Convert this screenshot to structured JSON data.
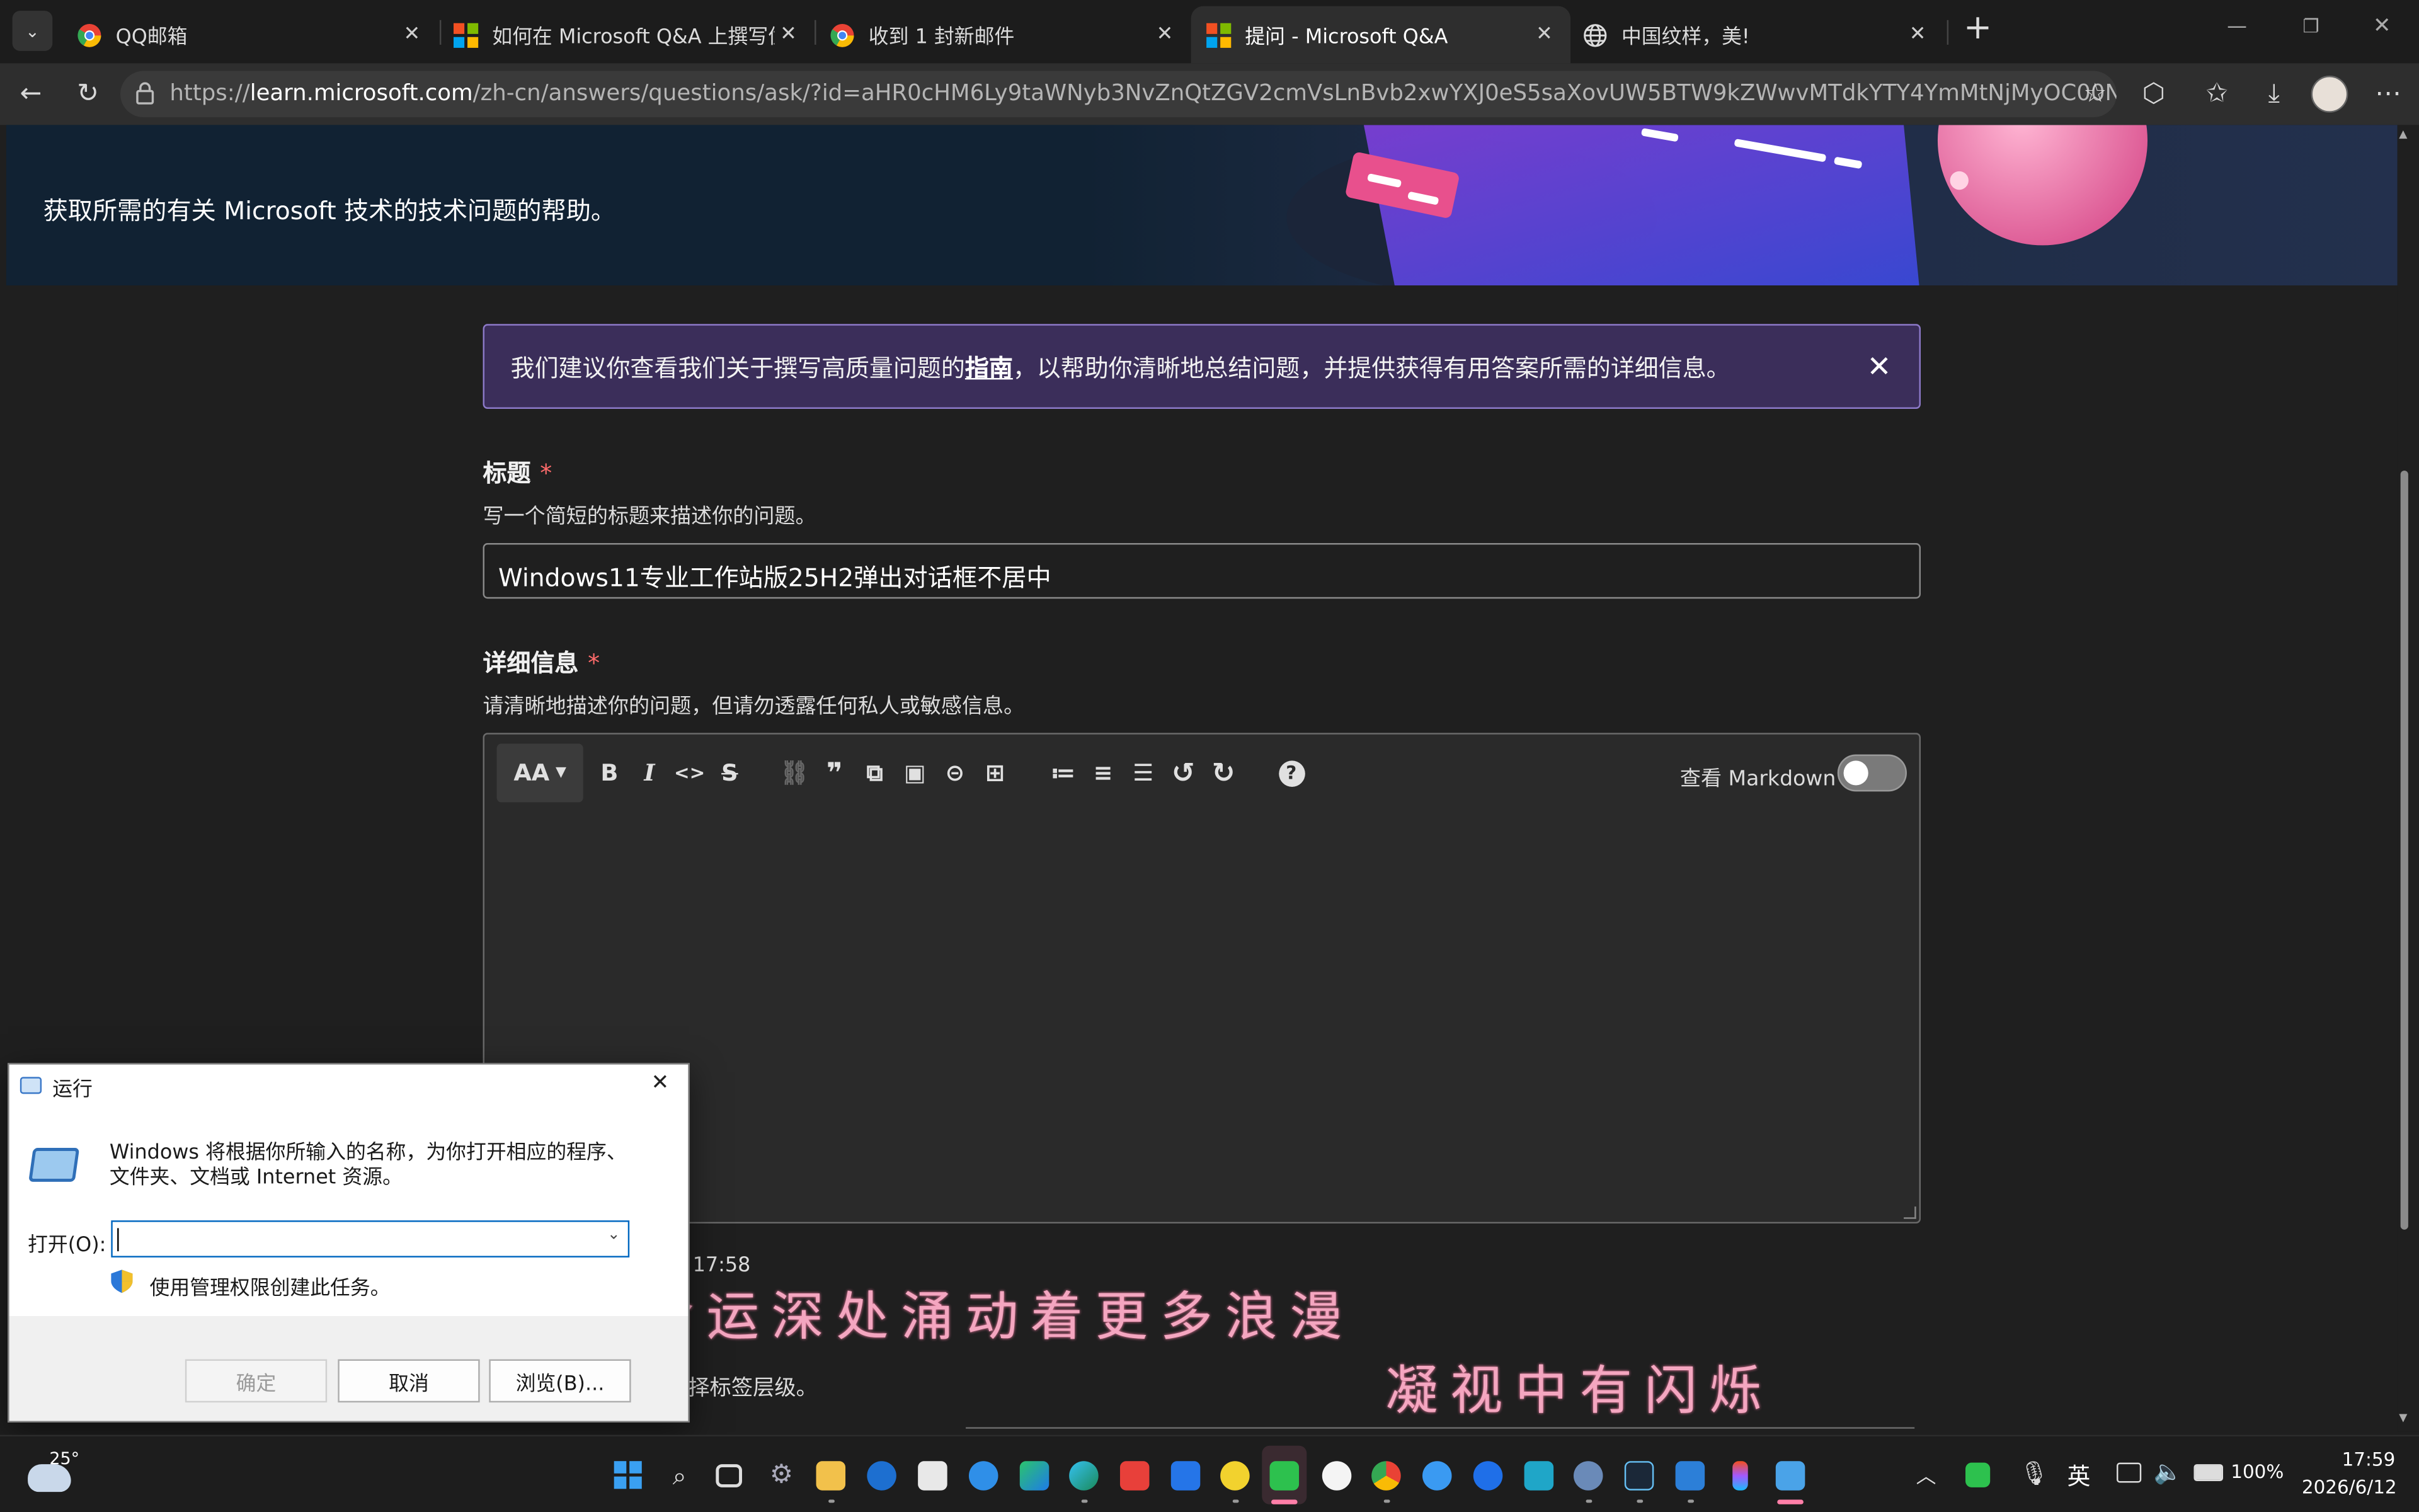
{
  "browser": {
    "tabs": [
      {
        "title": "QQ邮箱",
        "icon": "chrome-like-icon"
      },
      {
        "title": "如何在 Microsoft Q&A 上撰写优质",
        "icon": "microsoft-logo-icon"
      },
      {
        "title": "收到 1 封新邮件",
        "icon": "chrome-like-icon"
      },
      {
        "title": "提问 - Microsoft Q&A",
        "icon": "microsoft-logo-icon",
        "active": true
      },
      {
        "title": "中国纹样，美!",
        "icon": "globe-icon"
      }
    ],
    "url_prefix": "https://",
    "url_domain": "learn.microsoft.com",
    "url_path": "/zh-cn/answers/questions/ask/?id=aHR0cHM6Ly9taWNyb3NvZnQtZGV2cmVsLnBvb2xwYXJ0eS5saXovUW5BTW9kZWwvMTdkYTY4YmMtNjMyOC00NTY4LWJmNDktN..."
  },
  "page": {
    "banner_text": "获取所需的有关 Microsoft 技术的技术问题的帮助。",
    "notice": {
      "before": "我们建议你查看我们关于撰写高质量问题的",
      "link": "指南",
      "after": "，以帮助你清晰地总结问题，并提供获得有用答案所需的详细信息。"
    },
    "title_field": {
      "label": "标题",
      "required_mark": "*",
      "help": "写一个简短的标题来描述你的问题。",
      "value": "Windows11专业工作站版25H2弹出对话框不居中"
    },
    "details_field": {
      "label": "详细信息",
      "required_mark": "*",
      "help": "请清晰地描述你的问题，但请勿透露任何私人或敏感信息。"
    },
    "editor": {
      "toolbar": [
        {
          "glyph": "B",
          "name": "bold-icon"
        },
        {
          "glyph": "I",
          "name": "italic-icon"
        },
        {
          "glyph": "<>",
          "name": "code-icon"
        },
        {
          "glyph": "S",
          "name": "strikethrough-icon"
        },
        {
          "glyph": "⛓",
          "name": "link-icon",
          "disabled": true
        },
        {
          "glyph": "❞",
          "name": "quote-icon"
        },
        {
          "glyph": "⧉",
          "name": "code-block-icon"
        },
        {
          "glyph": "▣",
          "name": "image-icon"
        },
        {
          "glyph": "⊝",
          "name": "embed-icon"
        },
        {
          "glyph": "⊞",
          "name": "table-icon"
        },
        {
          "glyph": "≔",
          "name": "numbered-list-icon"
        },
        {
          "glyph": "≡",
          "name": "bulleted-list-icon"
        },
        {
          "glyph": "☰",
          "name": "align-icon"
        },
        {
          "glyph": "↺",
          "name": "undo-icon"
        },
        {
          "glyph": "↻",
          "name": "redo-icon"
        },
        {
          "glyph": "?",
          "name": "help-icon"
        }
      ],
      "format_label": "AA",
      "markdown_label": "查看 Markdown",
      "markdown_on": false
    },
    "partial_time": "17:58",
    "partial_hint": "择标签层级。"
  },
  "overlay": {
    "line1": "命运深处涌动着更多浪漫",
    "line2": "凝视中有闪烁"
  },
  "run_dialog": {
    "title": "运行",
    "description": "Windows 将根据你所输入的名称，为你打开相应的程序、文件夹、文档或 Internet 资源。",
    "open_label": "打开(O):",
    "open_value": "",
    "admin_note": "使用管理权限创建此任务。",
    "ok": "确定",
    "cancel": "取消",
    "browse": "浏览(B)..."
  },
  "taskbar": {
    "weather_temp": "25°",
    "ime": "英",
    "battery": "100%",
    "time": "17:59",
    "date": "2026/6/12"
  },
  "colors": {
    "accent": "#8c79c8",
    "notice_bg": "#3b2e5a",
    "required": "#ff6b6b",
    "overlay_text": "#f4a6c0"
  }
}
